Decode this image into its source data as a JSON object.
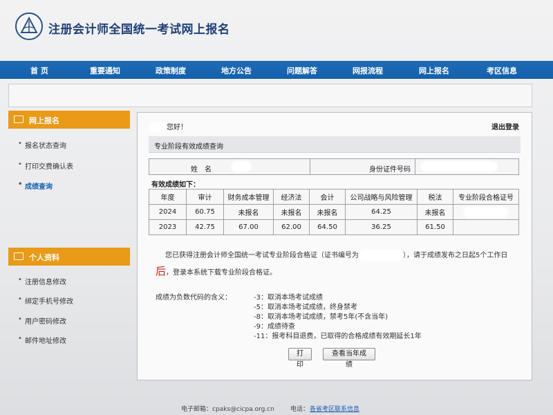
{
  "header": {
    "title": "注册会计师全国统一考试网上报名"
  },
  "nav": [
    "首 页",
    "重要通知",
    "政策制度",
    "地方公告",
    "问题解答",
    "网报流程",
    "网上报名",
    "考区信息"
  ],
  "sidebar": {
    "section1": {
      "title": "网上报名",
      "items": [
        "报名状态查询",
        "打印交费确认表",
        "成绩查询"
      ]
    },
    "section2": {
      "title": "个人资料",
      "items": [
        "注册信息修改",
        "绑定手机号修改",
        "用户密码修改",
        "邮件地址修改"
      ]
    }
  },
  "panel": {
    "greeting": "您好！",
    "logout": "退出登录",
    "subtitle": "专业阶段有效成绩查询",
    "name_label": "姓　名",
    "id_label": "身份证件号码",
    "valid_label": "有效成绩如下：",
    "table": {
      "headers": [
        "年度",
        "审计",
        "财务成本管理",
        "经济法",
        "会计",
        "公司战略与风险管理",
        "税法",
        "专业阶段合格证号"
      ],
      "rows": [
        [
          "2024",
          "60.75",
          "未报名",
          "未报名",
          "未报名",
          "64.25",
          "未报名",
          ""
        ],
        [
          "2023",
          "42.75",
          "67.00",
          "62.00",
          "64.50",
          "36.25",
          "61.50",
          ""
        ]
      ]
    },
    "notice_a": "您已获得注册会计师全国统一考试专业阶段合格证（证书编号为",
    "notice_b": "），请于成绩发布之日起5个工作日",
    "notice_red": "后",
    "notice_c": "，登录本系统下载专业阶段合格证。",
    "codes_label": "成绩为负数代码的含义：",
    "codes": [
      "-3：取消本场考试成绩",
      "-5：取消本场考试成绩，终身禁考",
      "-8：取消本场考试成绩，禁考5年(不含当年)",
      "-9：成绩待查",
      "-11：报考科目退费，已取得的合格成绩有效期延长1年"
    ],
    "print_button": "打印",
    "view_button": "查看当年成绩"
  },
  "footer": {
    "email": "电子邮箱：cpaks@cicpa.org.cn",
    "phone_label": "电话：",
    "phone_link": "各省考区联系信息"
  },
  "colors": {
    "nav_blue": "#1560a9",
    "side_orange": "#e99a17",
    "title_blue": "#1f3f7a",
    "active_blue": "#1a66b3",
    "red": "#d0201a"
  }
}
